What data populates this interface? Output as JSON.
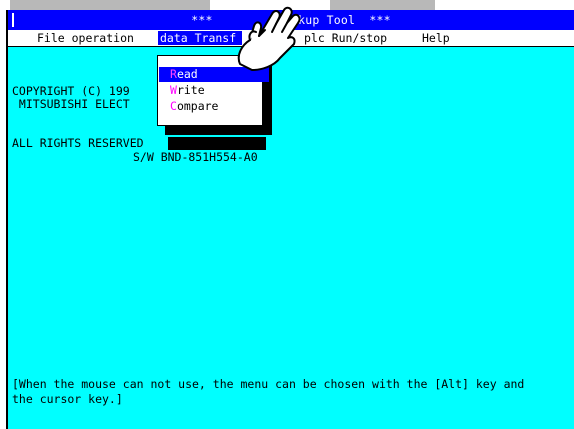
{
  "title_bar": {
    "title": "***          ackup Tool  ***"
  },
  "menu_bar": {
    "items": [
      {
        "label": "File operation"
      },
      {
        "label": "data Transf"
      },
      {
        "label": "plc Run/stop"
      },
      {
        "label": "Help"
      }
    ]
  },
  "dropdown": {
    "items": [
      {
        "hotkey": "R",
        "rest": "ead"
      },
      {
        "hotkey": "W",
        "rest": "rite"
      },
      {
        "hotkey": "C",
        "rest": "ompare"
      }
    ]
  },
  "content": {
    "copyright_line": "COPYRIGHT (C) 199",
    "company_line": " MITSUBISHI ELECT",
    "rights_line": "ALL RIGHTS RESERVED",
    "software_line": "S/W BND-851H554-A0",
    "help_line_1": "[When the mouse can not use, the menu can be chosen with the [Alt] key and",
    "help_line_2": "the cursor key.]"
  },
  "colors": {
    "title_background": "#0000ff",
    "main_background": "#00ffff",
    "hotkey": "#ff00ff",
    "selected_item": "#0000ff"
  },
  "icons": [
    "hand-pointer-icon"
  ]
}
